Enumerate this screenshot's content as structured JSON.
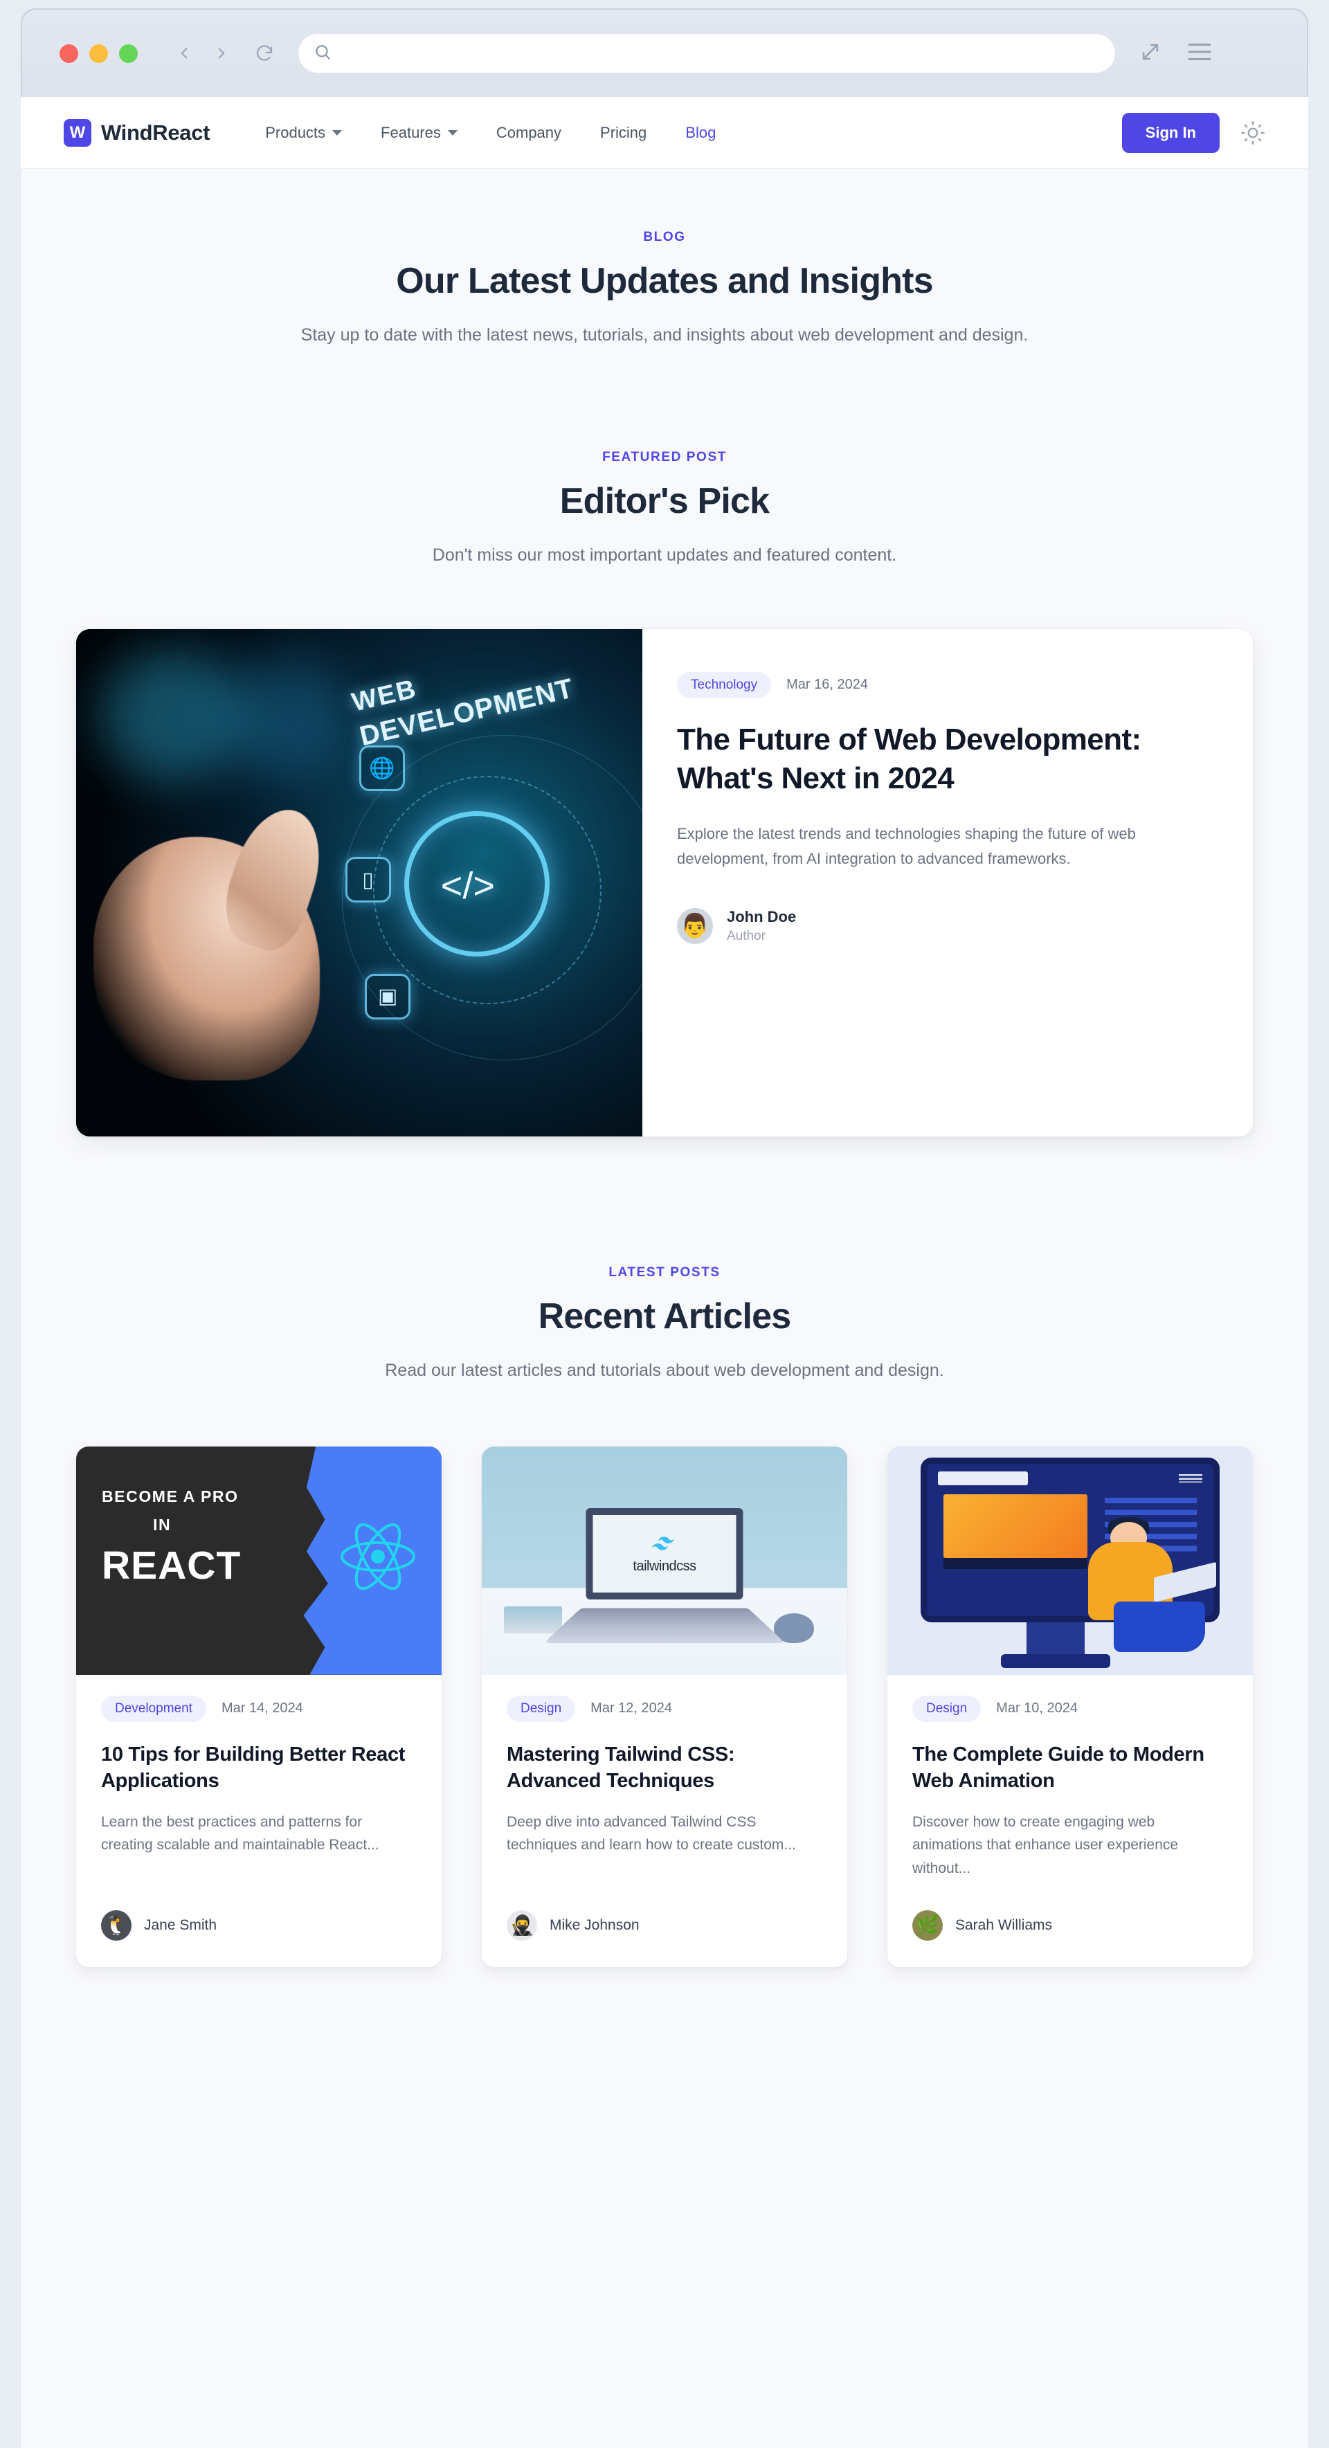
{
  "browser": {
    "url_value": "",
    "url_placeholder": "",
    "back_icon": "chevron-left-icon",
    "forward_icon": "chevron-right-icon",
    "reload_icon": "reload-icon",
    "search_icon": "search-icon",
    "share_icon": "expand-arrow-icon",
    "menu_icon": "hamburger-menu-icon"
  },
  "header": {
    "brand_mark": "W",
    "brand_name": "WindReact",
    "nav": [
      {
        "label": "Products",
        "has_caret": true
      },
      {
        "label": "Features",
        "has_caret": true
      },
      {
        "label": "Company",
        "has_caret": false
      },
      {
        "label": "Pricing",
        "has_caret": false
      },
      {
        "label": "Blog",
        "has_caret": false,
        "accent": true
      }
    ],
    "sign_in_label": "Sign In",
    "theme_toggle_icon": "sun-icon"
  },
  "hero": {
    "eyebrow": "BLOG",
    "title": "Our Latest Updates and Insights",
    "subtitle": "Stay up to date with the latest news, tutorials, and insights about web development and design."
  },
  "featured_section": {
    "eyebrow": "FEATURED POST",
    "title": "Editor's Pick",
    "subtitle": "Don't miss our most important updates and featured content."
  },
  "featured_post": {
    "category": "Technology",
    "date": "Mar 16, 2024",
    "title": "The Future of Web Development: What's Next in 2024",
    "excerpt": "Explore the latest trends and technologies shaping the future of web development, from AI integration to advanced frameworks.",
    "author_name": "John Doe",
    "author_role": "Author",
    "image_text_line1": "WEB",
    "image_text_line2": "DEVELOPMENT",
    "image_alt": "hand touching glowing web development hologram"
  },
  "latest_section": {
    "eyebrow": "LATEST POSTS",
    "title": "Recent Articles",
    "subtitle": "Read our latest articles and tutorials about web development and design."
  },
  "posts": [
    {
      "category": "Development",
      "date": "Mar 14, 2024",
      "title": "10 Tips for Building Better React Applications",
      "excerpt": "Learn the best practices and patterns for creating scalable and maintainable React...",
      "author_name": "Jane Smith",
      "avatar_kind": "penguin",
      "avatar_glyph": "🐧",
      "thumb_kind": "react",
      "thumb_line1": "BECOME A PRO",
      "thumb_line2": "IN",
      "thumb_line3": "REACT"
    },
    {
      "category": "Design",
      "date": "Mar 12, 2024",
      "title": "Mastering Tailwind CSS: Advanced Techniques",
      "excerpt": "Deep dive into advanced Tailwind CSS techniques and learn how to create custom...",
      "author_name": "Mike Johnson",
      "avatar_kind": "hood",
      "avatar_glyph": "🥷",
      "thumb_kind": "tailwind",
      "thumb_word": "tailwindcss"
    },
    {
      "category": "Design",
      "date": "Mar 10, 2024",
      "title": "The Complete Guide to Modern Web Animation",
      "excerpt": "Discover how to create engaging web animations that enhance user experience without...",
      "author_name": "Sarah Williams",
      "avatar_kind": "pine",
      "avatar_glyph": "🌿",
      "thumb_kind": "animation"
    }
  ],
  "colors": {
    "accent": "#4f46e5",
    "chip_bg": "#eef0fd",
    "page_bg": "#f8f9fc",
    "card_bg": "#ffffff",
    "heading": "#1e293b",
    "muted": "#6b7280"
  }
}
